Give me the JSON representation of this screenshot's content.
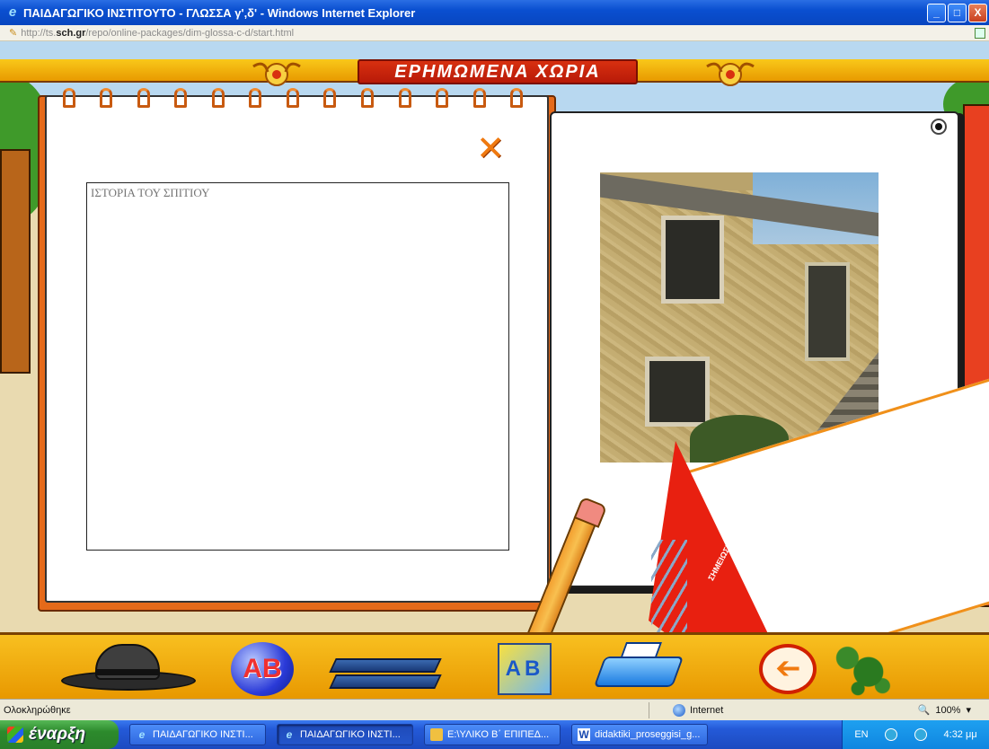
{
  "window": {
    "title": "ΠΑΙΔΑΓΩΓΙΚΟ ΙΝΣΤΙΤΟΥΤΟ - ΓΛΩΣΣΑ γ',δ' - Windows Internet Explorer",
    "minimize": "_",
    "maximize": "□",
    "close": "X"
  },
  "address": {
    "prefix": "http://ts.",
    "domain": "sch.gr",
    "path": "/repo/online-packages/dim-glossa-c-d/start.html"
  },
  "banner": {
    "title": "ΕΡΗΜΩΜΕΝΑ ΧΩΡΙΑ"
  },
  "notebook": {
    "close_symbol": "✕",
    "story_placeholder": "ΙΣΤΟΡΙΑ ΤΟΥ ΣΠΙΤΙΟΥ"
  },
  "notepad": {
    "cover_label": "ΣΗΜΕΙΩΣΕΙΣ"
  },
  "toolbar": {
    "ab_label": "AB",
    "blocks_label": "AB",
    "back_symbol": "➔",
    "icons": [
      "hat-icon",
      "ab-ball-icon",
      "books-icon",
      "blocks-icon",
      "printer-icon",
      "back-arrow-icon",
      "greece-map-icon"
    ]
  },
  "status": {
    "text": "Ολοκληρώθηκε",
    "zone": "Internet",
    "zoom": "100%"
  },
  "taskbar": {
    "start_label": "έναρξη",
    "tasks": [
      "ΠΑΙΔΑΓΩΓΙΚΟ ΙΝΣΤΙ...",
      "ΠΑΙΔΑΓΩΓΙΚΟ ΙΝΣΤΙ...",
      "E:\\ΥΛΙΚΟ Β΄ ΕΠΙΠΕΔ...",
      "didaktiki_proseggisi_g..."
    ],
    "lang": "EN",
    "clock": "4:32 μμ"
  },
  "colors": {
    "banner": "#c82810",
    "toolbar": "#f0a800",
    "notebook_edge": "#e56a1a"
  }
}
